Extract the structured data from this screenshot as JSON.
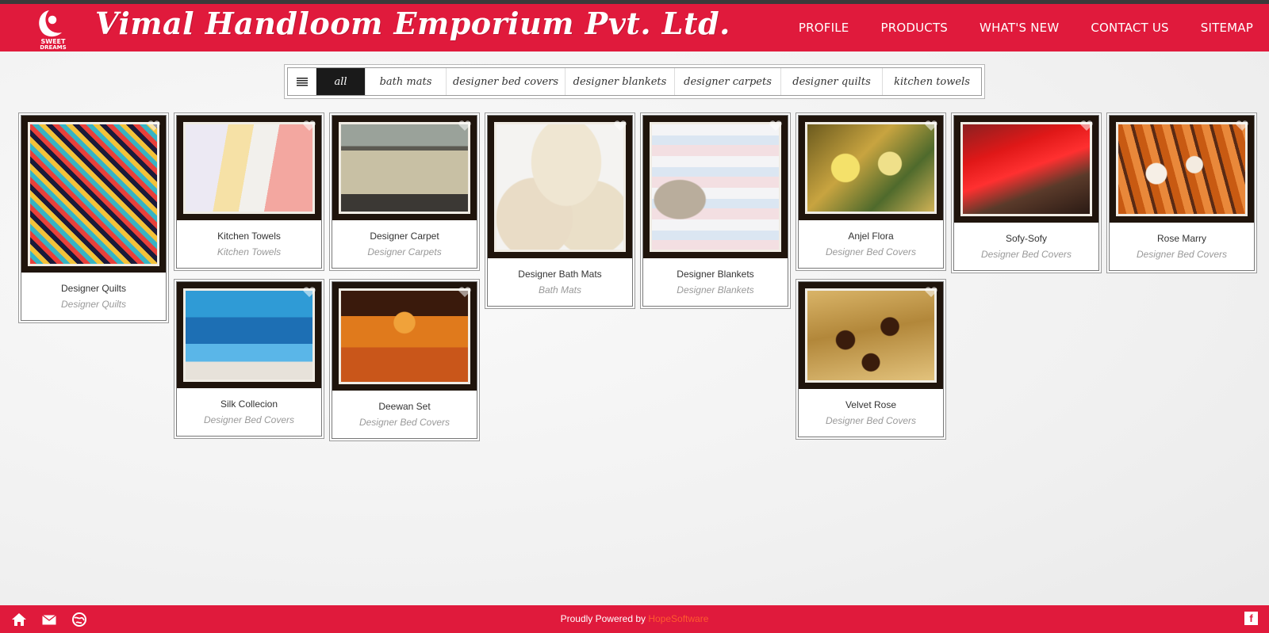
{
  "site": {
    "brand": "Vimal Handloom Emporium Pvt. Ltd.",
    "logo_text": "SWEET DREAMS",
    "accent_color": "#e01a3c"
  },
  "nav": [
    "PROFILE",
    "PRODUCTS",
    "WHAT'S NEW",
    "CONTACT US",
    "SITEMAP"
  ],
  "filters": [
    "all",
    "bath mats",
    "designer bed covers",
    "designer blankets",
    "designer carpets",
    "designer quilts",
    "kitchen towels"
  ],
  "products": [
    {
      "title": "Designer Quilts",
      "category": "Designer Quilts"
    },
    {
      "title": "Kitchen Towels",
      "category": "Kitchen Towels"
    },
    {
      "title": "Designer Carpet",
      "category": "Designer Carpets"
    },
    {
      "title": "Designer Bath Mats",
      "category": "Bath Mats"
    },
    {
      "title": "Designer Blankets",
      "category": "Designer Blankets"
    },
    {
      "title": "Anjel Flora",
      "category": "Designer Bed Covers"
    },
    {
      "title": "Sofy-Sofy",
      "category": "Designer Bed Covers"
    },
    {
      "title": "Rose Marry",
      "category": "Designer Bed Covers"
    },
    {
      "title": "Silk Collecion",
      "category": "Designer Bed Covers"
    },
    {
      "title": "Deewan Set",
      "category": "Designer Bed Covers"
    },
    {
      "title": "Velvet Rose",
      "category": "Designer Bed Covers"
    }
  ],
  "footer": {
    "powered_text": "Proudly Powered by",
    "powered_brand": "HopeSoftware",
    "fb_label": "f"
  }
}
